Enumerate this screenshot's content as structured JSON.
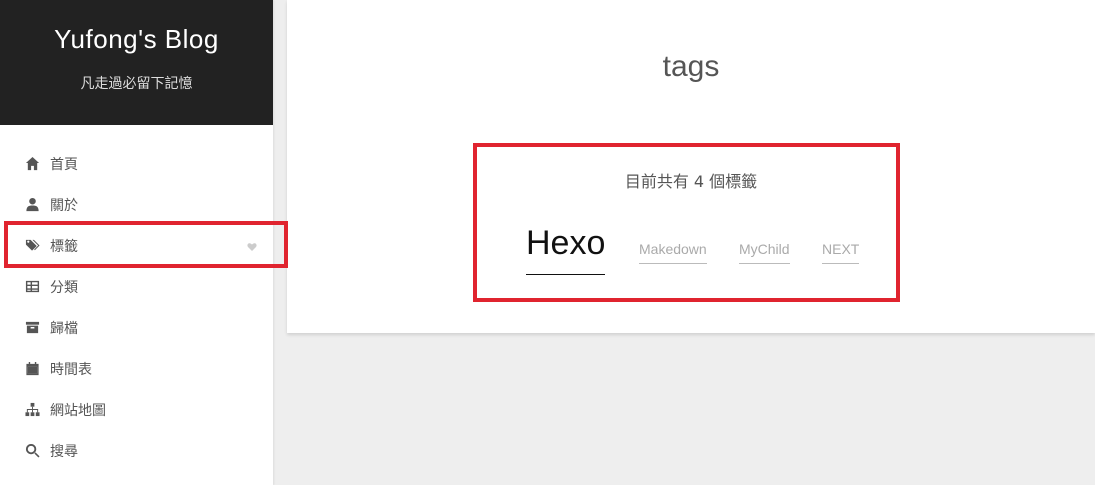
{
  "site": {
    "title": "Yufong's Blog",
    "subtitle": "凡走過必留下記憶"
  },
  "menu": {
    "items": [
      {
        "label": "首頁",
        "icon": "home-icon"
      },
      {
        "label": "關於",
        "icon": "user-icon"
      },
      {
        "label": "標籤",
        "icon": "tags-icon",
        "active": true
      },
      {
        "label": "分類",
        "icon": "table-icon"
      },
      {
        "label": "歸檔",
        "icon": "archive-icon"
      },
      {
        "label": "時間表",
        "icon": "calendar-icon"
      },
      {
        "label": "網站地圖",
        "icon": "sitemap-icon"
      },
      {
        "label": "搜尋",
        "icon": "search-icon"
      }
    ]
  },
  "main": {
    "title": "tags",
    "tag_count_text": "目前共有 4 個標籤",
    "tags": [
      "Hexo",
      "Makedown",
      "MyChild",
      "NEXT"
    ]
  },
  "colors": {
    "brand_bg": "#222222",
    "highlight": "#e0242f",
    "page_bg": "#eeeeee"
  }
}
